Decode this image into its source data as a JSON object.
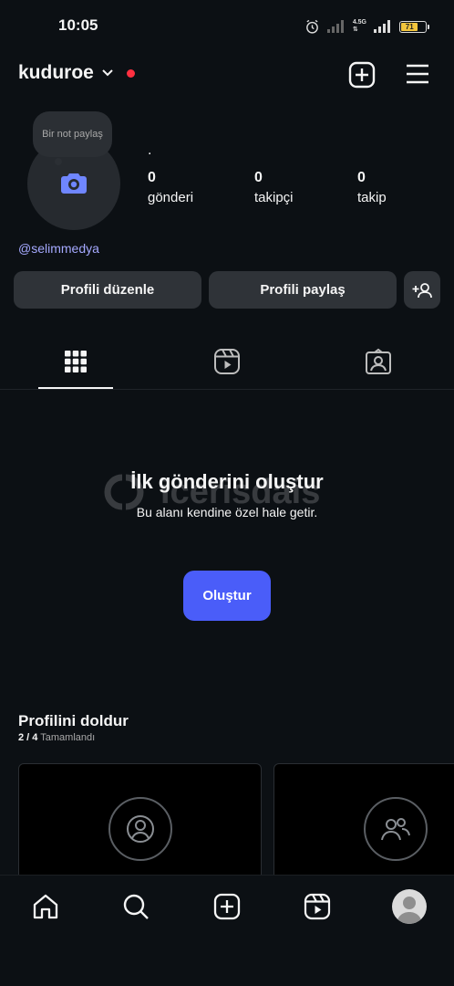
{
  "status_bar": {
    "time": "10:05",
    "network_label": "4.5G",
    "battery_level": "71"
  },
  "header": {
    "username": "kuduroe",
    "icons": [
      "chevron-down-icon",
      "new-post-icon",
      "menu-icon"
    ]
  },
  "profile": {
    "note_text": "Bir not paylaş",
    "display_name": ".",
    "stats": [
      {
        "value": "0",
        "label": "gönderi"
      },
      {
        "value": "0",
        "label": "takipçi"
      },
      {
        "value": "0",
        "label": "takip"
      }
    ],
    "handle": "@selimmedya",
    "buttons": {
      "edit": "Profili düzenle",
      "share": "Profili paylaş"
    }
  },
  "tabs": [
    "grid-icon",
    "reels-icon",
    "tagged-icon"
  ],
  "empty_state": {
    "title": "İlk gönderini oluştur",
    "subtitle": "Bu alanı kendine özel hale getir.",
    "create_label": "Oluştur"
  },
  "watermark_text": "icerisdais",
  "complete_profile": {
    "title": "Profilini doldur",
    "progress": "2 / 4",
    "progress_label": "Tamamlandı"
  },
  "bottom_nav": [
    "home-icon",
    "search-icon",
    "create-icon",
    "reels-icon",
    "profile-avatar"
  ],
  "colors": {
    "background": "#0c1014",
    "accent": "#4a5df9",
    "notification": "#ff3040",
    "link": "#a5a9ff"
  }
}
